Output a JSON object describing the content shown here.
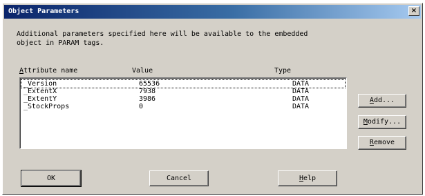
{
  "dialog": {
    "title": "Object Parameters",
    "close_glyph": "×",
    "description": "Additional parameters specified here will be available to the embedded\nobject in PARAM tags."
  },
  "table": {
    "headers": {
      "attribute_first": "A",
      "attribute_rest": "ttribute name",
      "value": "Value",
      "type": "Type"
    },
    "rows": [
      {
        "name": "_Version",
        "value": "65536",
        "type": "DATA",
        "selected": true
      },
      {
        "name": "_ExtentX",
        "value": "7938",
        "type": "DATA",
        "selected": false
      },
      {
        "name": "_ExtentY",
        "value": "3986",
        "type": "DATA",
        "selected": false
      },
      {
        "name": "_StockProps",
        "value": "0",
        "type": "DATA",
        "selected": false
      }
    ]
  },
  "side_buttons": {
    "add": {
      "mnemonic": "A",
      "rest": "dd..."
    },
    "modify": {
      "mnemonic": "M",
      "rest": "odify..."
    },
    "remove": {
      "mnemonic": "R",
      "rest": "emove"
    }
  },
  "bottom_buttons": {
    "ok": "OK",
    "cancel": "Cancel",
    "help": {
      "mnemonic": "H",
      "rest": "elp"
    }
  }
}
